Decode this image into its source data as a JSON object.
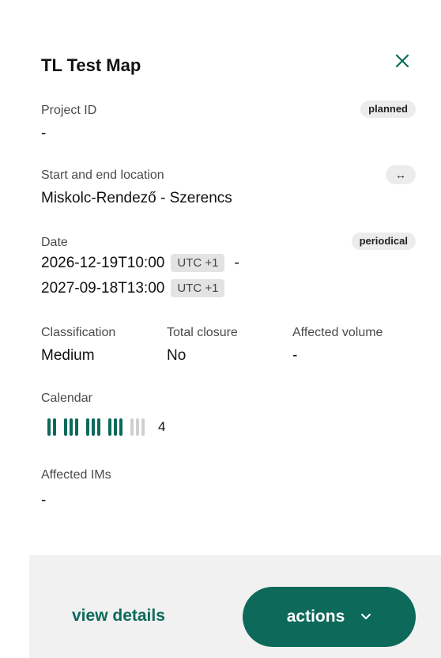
{
  "header": {
    "title": "TL Test Map"
  },
  "project": {
    "label": "Project ID",
    "value": "-",
    "status": "planned"
  },
  "location": {
    "label": "Start and end location",
    "value": "Miskolc-Rendező - Szerencs",
    "swap_symbol": "↔"
  },
  "date": {
    "label": "Date",
    "badge": "periodical",
    "start": "2026-12-19T10:00",
    "start_tz": "UTC +1",
    "separator": "-",
    "end": "2027-09-18T13:00",
    "end_tz": "UTC +1"
  },
  "details": {
    "classification_label": "Classification",
    "classification_value": "Medium",
    "closure_label": "Total closure",
    "closure_value": "No",
    "volume_label": "Affected volume",
    "volume_value": "-"
  },
  "calendar": {
    "label": "Calendar",
    "count": "4",
    "groups": [
      [
        1,
        1
      ],
      [
        1,
        1,
        1
      ],
      [
        1,
        1,
        1
      ],
      [
        1,
        1,
        1
      ],
      [
        0,
        0,
        0
      ]
    ],
    "active_color": "#0d6a5b",
    "inactive_color": "#cfcfcf"
  },
  "ims": {
    "label": "Affected IMs",
    "value": "-"
  },
  "footer": {
    "view_details": "view details",
    "actions": "actions"
  },
  "icons": {
    "close": "close-icon",
    "swap": "swap-arrows-icon",
    "actions_chevron": "chevron-down-icon"
  },
  "colors": {
    "accent": "#0d6a5b",
    "footer_bg": "#f1f1f1",
    "badge_bg": "#ececec"
  }
}
